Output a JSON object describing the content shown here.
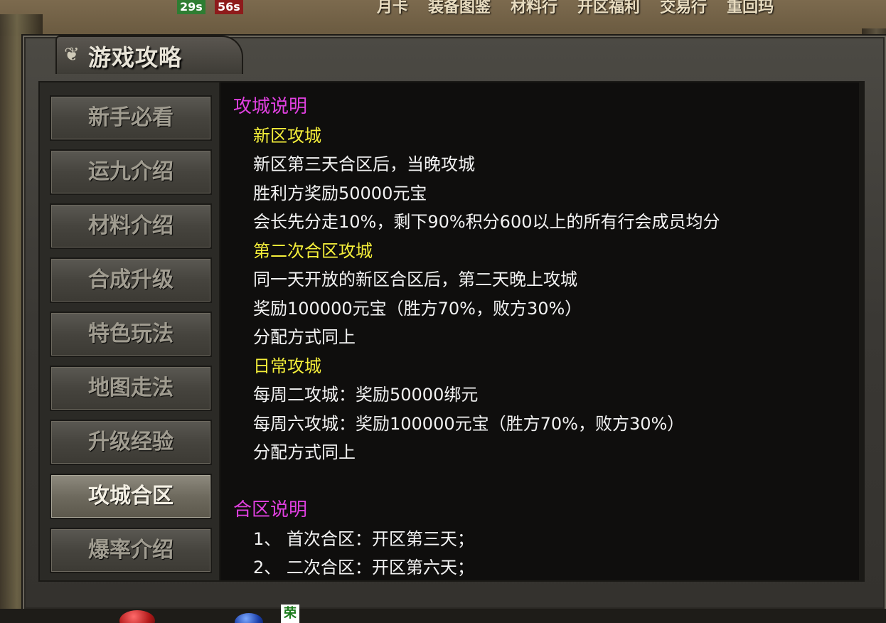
{
  "hud": {
    "timer_green": "29s",
    "timer_red": "56s",
    "top_menu": [
      "月卡",
      "装备图鉴",
      "材料行",
      "开区福利",
      "交易行",
      "重回玛"
    ],
    "bottom_badge": "荣"
  },
  "window": {
    "title": "游戏攻略",
    "title_ornament_icon": "wing-ornament-icon"
  },
  "sidebar": {
    "items": [
      {
        "label": "新手必看",
        "active": false
      },
      {
        "label": "运九介绍",
        "active": false
      },
      {
        "label": "材料介绍",
        "active": false
      },
      {
        "label": "合成升级",
        "active": false
      },
      {
        "label": "特色玩法",
        "active": false
      },
      {
        "label": "地图走法",
        "active": false
      },
      {
        "label": "升级经验",
        "active": false
      },
      {
        "label": "攻城合区",
        "active": true
      },
      {
        "label": "爆率介绍",
        "active": false
      }
    ]
  },
  "content": {
    "lines": [
      {
        "type": "section",
        "text": "攻城说明"
      },
      {
        "type": "sub",
        "text": "新区攻城"
      },
      {
        "type": "body",
        "text": "新区第三天合区后，当晚攻城"
      },
      {
        "type": "body",
        "text": "胜利方奖励50000元宝"
      },
      {
        "type": "body",
        "text": "会长先分走10%，剩下90%积分600以上的所有行会成员均分"
      },
      {
        "type": "sub",
        "text": "第二次合区攻城"
      },
      {
        "type": "body",
        "text": "同一天开放的新区合区后，第二天晚上攻城"
      },
      {
        "type": "body",
        "text": "奖励100000元宝（胜方70%，败方30%）"
      },
      {
        "type": "body",
        "text": "分配方式同上"
      },
      {
        "type": "sub",
        "text": "日常攻城"
      },
      {
        "type": "body",
        "text": "每周二攻城：奖励50000绑元"
      },
      {
        "type": "body",
        "text": "每周六攻城：奖励100000元宝（胜方70%，败方30%）"
      },
      {
        "type": "body",
        "text": "分配方式同上"
      },
      {
        "type": "blank",
        "text": ""
      },
      {
        "type": "section",
        "text": "合区说明"
      },
      {
        "type": "item",
        "text": "1、 首次合区：开区第三天；"
      },
      {
        "type": "item",
        "text": "2、 二次合区：开区第六天；"
      }
    ]
  },
  "colors": {
    "section": "#e040e0",
    "sub": "#f5ef3a",
    "body": "#f2f2f2",
    "panel_bg": "#0f0e0d"
  }
}
